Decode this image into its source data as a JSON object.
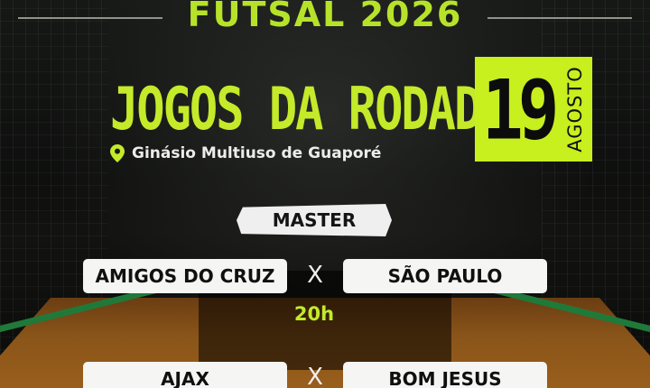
{
  "header": {
    "title": "FUTSAL 2026",
    "subtitle": "JOGOS DA RODADA"
  },
  "venue": {
    "icon": "location-pin-icon",
    "name": "Ginásio Multiuso de Guaporé"
  },
  "date": {
    "day": "19",
    "month": "AGOSTO"
  },
  "category": "MASTER",
  "matches": [
    {
      "home": "AMIGOS DO CRUZ",
      "separator": "X",
      "away": "SÃO PAULO",
      "time": "20h"
    },
    {
      "home": "AJAX",
      "separator": "X",
      "away": "BOM JESUS"
    }
  ],
  "colors": {
    "accent": "#c4ea2a",
    "date_box": "#c8ef1e",
    "background": "#0e0f0e",
    "floor": "#8a5519"
  }
}
